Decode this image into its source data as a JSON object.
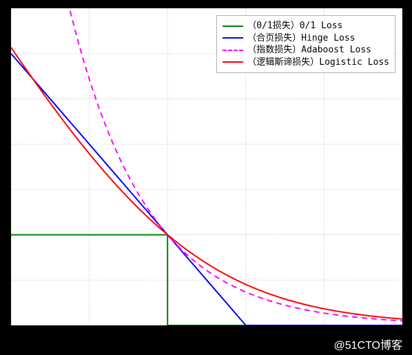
{
  "watermark": "@51CTO博客",
  "legend": {
    "items": [
      {
        "label": "（0/1损失）0/1 Loss",
        "color": "#008000",
        "dash": "solid"
      },
      {
        "label": "（合页损失）Hinge Loss",
        "color": "#0000ff",
        "dash": "solid"
      },
      {
        "label": "（指数损失）Adaboost Loss",
        "color": "#ff00ff",
        "dash": "dashed"
      },
      {
        "label": "（逻辑斯谛损失）Logistic Loss",
        "color": "#ff0000",
        "dash": "solid"
      }
    ]
  },
  "chart_data": {
    "type": "line",
    "xlabel": "",
    "ylabel": "",
    "title": "",
    "xlim": [
      -2,
      3
    ],
    "ylim": [
      0,
      3.5
    ],
    "grid": true,
    "legend_position": "upper-right",
    "x": [
      -2.0,
      -1.5,
      -1.0,
      -0.5,
      0.0,
      0.5,
      1.0,
      1.5,
      2.0,
      2.5,
      3.0
    ],
    "series": [
      {
        "name": "（0/1损失）0/1 Loss",
        "color": "#008000",
        "dash": "solid",
        "values": [
          1.0,
          1.0,
          1.0,
          1.0,
          1.0,
          0.0,
          0.0,
          0.0,
          0.0,
          0.0,
          0.0
        ]
      },
      {
        "name": "（合页损失）Hinge Loss",
        "color": "#0000ff",
        "dash": "solid",
        "values": [
          3.0,
          2.5,
          2.0,
          1.5,
          1.0,
          0.5,
          0.0,
          0.0,
          0.0,
          0.0,
          0.0
        ]
      },
      {
        "name": "（指数损失）Adaboost Loss",
        "color": "#ff00ff",
        "dash": "dashed",
        "note": "exp(-x)",
        "values": [
          7.389,
          4.482,
          2.718,
          1.649,
          1.0,
          0.607,
          0.368,
          0.223,
          0.135,
          0.082,
          0.05
        ]
      },
      {
        "name": "（逻辑斯谛损失）Logistic Loss",
        "color": "#ff0000",
        "dash": "solid",
        "note": "log2(1+exp(-x))",
        "values": [
          3.059,
          2.378,
          1.876,
          1.381,
          1.0,
          0.689,
          0.452,
          0.284,
          0.172,
          0.102,
          0.059
        ]
      }
    ]
  }
}
